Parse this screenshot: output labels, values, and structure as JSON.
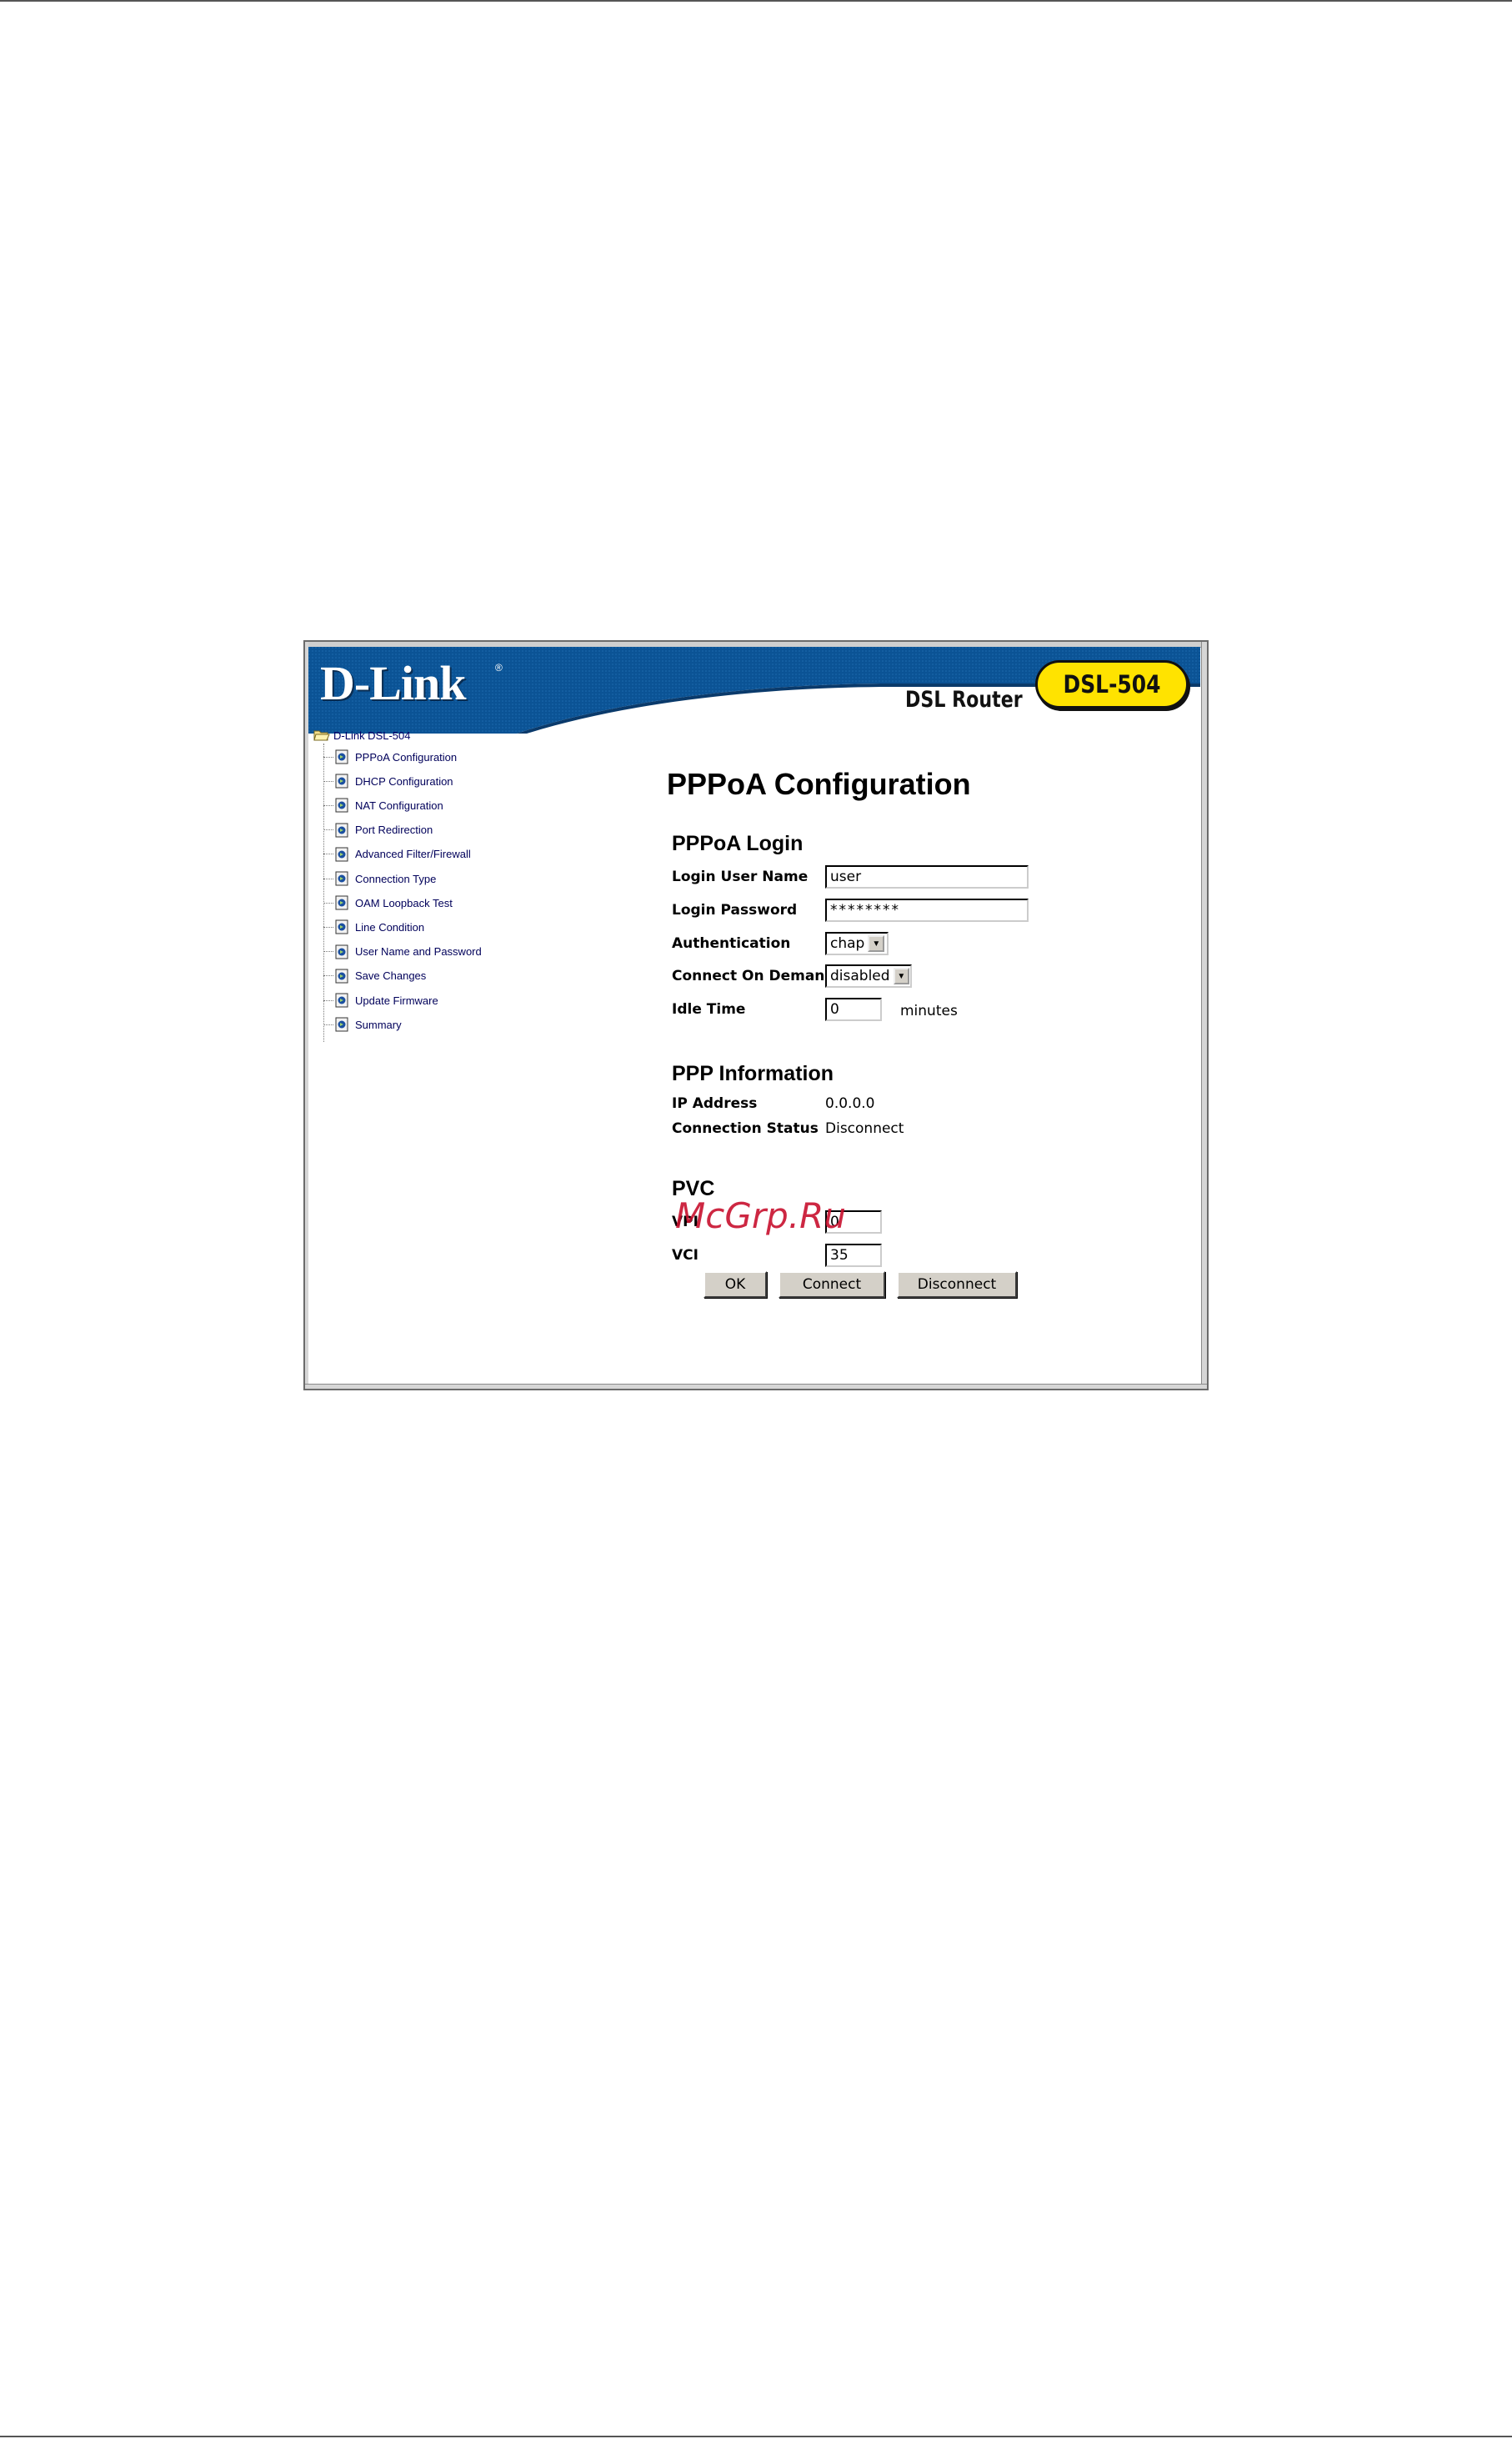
{
  "brand": {
    "logo_text": "D-Link",
    "product_name": "DSL Router",
    "model": "DSL-504",
    "banner_blue": "#0a4d8c",
    "badge_yellow": "#ffe300"
  },
  "tree": {
    "root_label": "D-Link DSL-504",
    "items": [
      {
        "label": "PPPoA Configuration"
      },
      {
        "label": "DHCP Configuration"
      },
      {
        "label": "NAT Configuration"
      },
      {
        "label": "Port Redirection"
      },
      {
        "label": "Advanced Filter/Firewall"
      },
      {
        "label": "Connection Type"
      },
      {
        "label": "OAM Loopback Test"
      },
      {
        "label": "Line Condition"
      },
      {
        "label": "User Name and Password"
      },
      {
        "label": "Save Changes"
      },
      {
        "label": "Update Firmware"
      },
      {
        "label": "Summary"
      }
    ]
  },
  "main": {
    "title": "PPPoA Configuration",
    "login": {
      "section_title": "PPPoA Login",
      "username_label": "Login User Name",
      "username_value": "user",
      "password_label": "Login Password",
      "password_value": "********",
      "auth_label": "Authentication",
      "auth_value": "chap",
      "demand_label": "Connect On Demand",
      "demand_value": "disabled",
      "idle_label": "Idle Time",
      "idle_value": "0",
      "idle_suffix": "minutes"
    },
    "ppp_info": {
      "section_title": "PPP Information",
      "ip_label": "IP Address",
      "ip_value": "0.0.0.0",
      "status_label": "Connection Status",
      "status_value": "Disconnect"
    },
    "pvc": {
      "section_title": "PVC",
      "vpi_label": "VPI",
      "vpi_value": "0",
      "vci_label": "VCI",
      "vci_value": "35"
    },
    "buttons": {
      "ok": "OK",
      "connect": "Connect",
      "disconnect": "Disconnect"
    }
  },
  "watermark": "McGrp.Ru"
}
